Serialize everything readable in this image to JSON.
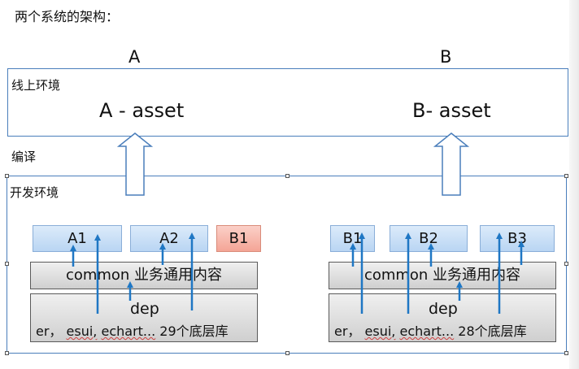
{
  "title": "两个系统的架构：",
  "columns": {
    "a": "A",
    "b": "B"
  },
  "online": {
    "label": "线上环境",
    "asset_a": "A - asset",
    "asset_b": "B- asset"
  },
  "compile_label": "编译",
  "dev": {
    "label": "开发环境",
    "left": {
      "modules": [
        "A1",
        "A2",
        "B1"
      ],
      "common": "common 业务通用内容",
      "dep": "dep",
      "libs": {
        "er": "er",
        "sep": "，",
        "esui": "esui,",
        "echart": "echart...",
        "count": "29个底层库"
      }
    },
    "right": {
      "modules": [
        "B1",
        "B2",
        "B3"
      ],
      "common": "common 业务通用内容",
      "dep": "dep",
      "libs": {
        "er": "er",
        "sep": "，",
        "esui": "esui,",
        "echart": "echart...",
        "count": "28个底层库"
      }
    }
  },
  "colors": {
    "frame": "#4a7ebb",
    "arrow": "#1f77c4",
    "module": "#cfe2f7",
    "module_alt": "#f6b1a3",
    "gray_box": "#dcdcdc"
  }
}
